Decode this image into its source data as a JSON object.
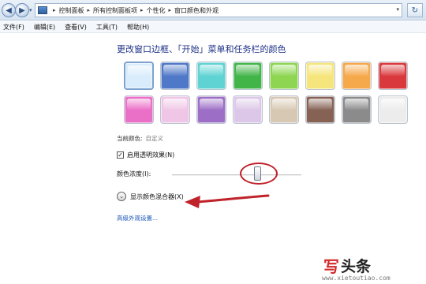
{
  "address_bar": {
    "breadcrumbs": [
      "控制面板",
      "所有控制面板项",
      "个性化",
      "窗口颜色和外观"
    ],
    "separator": "▸",
    "nav_back_glyph": "◀",
    "nav_forward_glyph": "▶",
    "dropdown_glyph": "▾",
    "refresh_glyph": "↻",
    "icon": "control-panel-icon"
  },
  "menu": {
    "items": [
      "文件(F)",
      "编辑(E)",
      "查看(V)",
      "工具(T)",
      "帮助(H)"
    ]
  },
  "main": {
    "heading": "更改窗口边框、「开始」菜单和任务栏的颜色",
    "swatches": [
      {
        "name": "sky",
        "color": "#d8ecfb",
        "selected": true
      },
      {
        "name": "twilight",
        "color": "#4f78c8",
        "selected": false
      },
      {
        "name": "sea",
        "color": "#5fd3d3",
        "selected": false
      },
      {
        "name": "leaf",
        "color": "#42b548",
        "selected": false
      },
      {
        "name": "lime",
        "color": "#8ed652",
        "selected": false
      },
      {
        "name": "lemon",
        "color": "#f6e57c",
        "selected": false
      },
      {
        "name": "pumpkin",
        "color": "#f6a94b",
        "selected": false
      },
      {
        "name": "ruby",
        "color": "#d9393c",
        "selected": false
      },
      {
        "name": "fuchsia",
        "color": "#ea6fc6",
        "selected": false
      },
      {
        "name": "blush",
        "color": "#f0c6e6",
        "selected": false
      },
      {
        "name": "violet",
        "color": "#9c6ec6",
        "selected": false
      },
      {
        "name": "lavender",
        "color": "#dcc7e8",
        "selected": false
      },
      {
        "name": "taupe",
        "color": "#d7c8b3",
        "selected": false
      },
      {
        "name": "chocolate",
        "color": "#866255",
        "selected": false
      },
      {
        "name": "slate",
        "color": "#8b8b8b",
        "selected": false
      },
      {
        "name": "frost",
        "color": "#ececec",
        "selected": false
      }
    ],
    "current_color_label": "当前颜色:",
    "current_color_value": "自定义",
    "transparency": {
      "label": "启用透明效果(N)",
      "checked": true,
      "check_glyph": "✓"
    },
    "intensity": {
      "label": "颜色浓度(I):",
      "value_fraction": 0.65
    },
    "mixer": {
      "label": "显示颜色混合器(X)",
      "expand_glyph": "⌄"
    },
    "advanced_link": "高级外观设置..."
  },
  "annotation": {
    "highlight_color": "#c0222a",
    "arrow_color": "#c0222a"
  },
  "watermark": {
    "logo": "写",
    "title": "头条",
    "url": "www.xietoutiao.com"
  }
}
